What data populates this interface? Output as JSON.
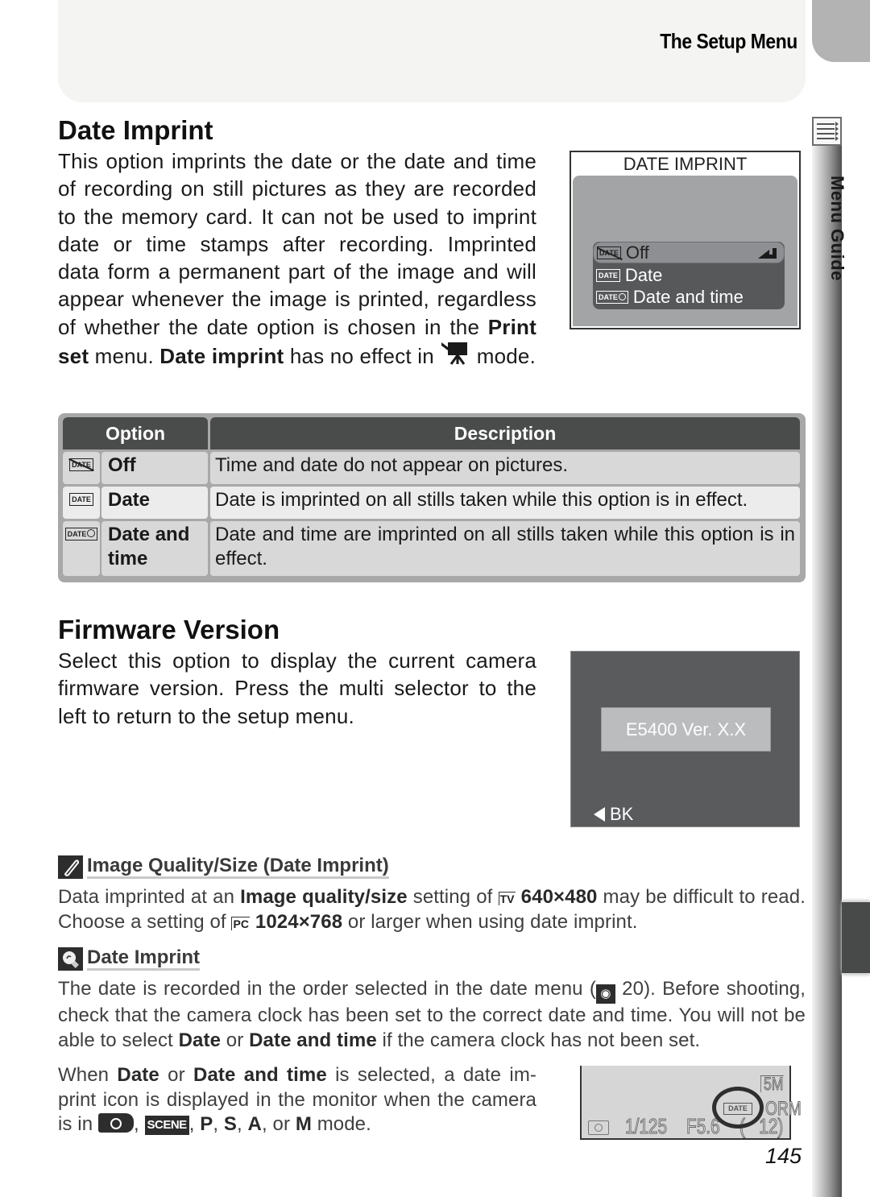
{
  "header": {
    "title": "The Setup Menu"
  },
  "sidebar": {
    "label": "Menu Guide",
    "icon": "menu-list-icon"
  },
  "date_imprint": {
    "heading": "Date Imprint",
    "paragraph": {
      "part1": "This option imprints the date or the date and time of recording on still pictures as they are recorded to the memory card.  It can not be used to imprint date or time stamps after recording. Imprinted data form a permanent part of the image and will appear whenever the image is printed, regardless of whether the date option is chosen in the ",
      "bold1": "Print set",
      "part2": " menu.  ",
      "bold2": "Date imprint",
      "part3": " has no effect in ",
      "mode_icon": "movie-camera-icon",
      "part4": " mode."
    },
    "screen": {
      "title": "DATE IMPRINT",
      "items": [
        {
          "icon_text": "DATE",
          "label": "Off",
          "selected": true
        },
        {
          "icon_text": "DATE",
          "label": "Date",
          "selected": false
        },
        {
          "icon_text": "DATE",
          "label": "Date and time",
          "selected": false
        }
      ],
      "enter_icon": "enter-arrow-icon"
    },
    "table": {
      "headers": [
        "Option",
        "Description"
      ],
      "rows": [
        {
          "icon_text": "DATE",
          "option": "Off",
          "description": "Time and date do not appear on pictures."
        },
        {
          "icon_text": "DATE",
          "option": "Date",
          "description": "Date is imprinted on all stills taken while this option is in effect."
        },
        {
          "icon_text": "DATE",
          "option": "Date and time",
          "description": "Date and time are imprinted on all stills taken while this option is in effect."
        }
      ]
    }
  },
  "firmware": {
    "heading": "Firmware Version",
    "paragraph": "Select this option to display the current camera firmware version.  Press the multi selector to the left to return to the setup menu.",
    "screen": {
      "version": "E5400 Ver. X.X",
      "back_label": "BK"
    }
  },
  "note_quality": {
    "title": "Image Quality/Size (Date Imprint)",
    "icon": "pencil-note-icon",
    "text": {
      "p1": "Data imprinted at an ",
      "b1": "Image quality/size",
      "p2": " setting of ",
      "icon1": "TV",
      "b2": "640×480",
      "p3": " may be difficult to read.  Choose a setting of ",
      "icon2": "PC",
      "b3": "1024×768",
      "p4": " or larger when using date imprint."
    }
  },
  "note_tip": {
    "title": "Date Imprint",
    "icon": "lightbulb-tip-icon",
    "text": {
      "p1": "The date is recorded in the order selected in the date menu (",
      "ref_page": "20",
      "p2": ").  Before shooting, check that the camera clock has been set to the correct date and time.  You will not be able to select ",
      "b1": "Date",
      "p3": " or ",
      "b2": "Date and time",
      "p4": " if the camera clock has not been set."
    },
    "text2": {
      "p1": "When ",
      "b1": "Date",
      "p2": " or ",
      "b2": "Date and time",
      "p3": " is selected, a date im-print icon is displayed in the monitor when the camera is in ",
      "scene": "SCENE",
      "p4": ", ",
      "bP": "P",
      "bS": "S",
      "bA": "A",
      "p5": ", or ",
      "bM": "M",
      "p6": " mode."
    },
    "monitor": {
      "size": "5M",
      "quality": "ORM",
      "shutter": "1/125",
      "aperture": "F5.6",
      "frames": "12",
      "date_icon": "DATE"
    }
  },
  "page_number": "145"
}
